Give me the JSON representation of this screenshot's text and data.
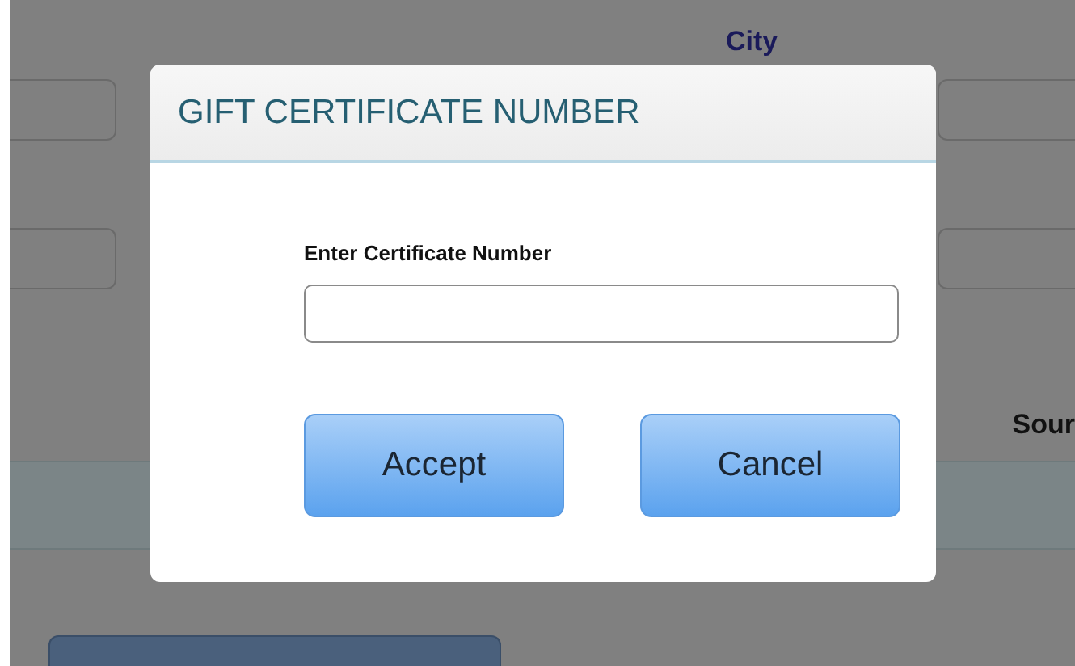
{
  "background": {
    "city_label": "City",
    "source_label": "Sour"
  },
  "dialog": {
    "title": "GIFT CERTIFICATE NUMBER",
    "field_label": "Enter Certificate Number",
    "buttons": [
      {
        "label": "Accept"
      },
      {
        "label": "Cancel"
      }
    ]
  }
}
